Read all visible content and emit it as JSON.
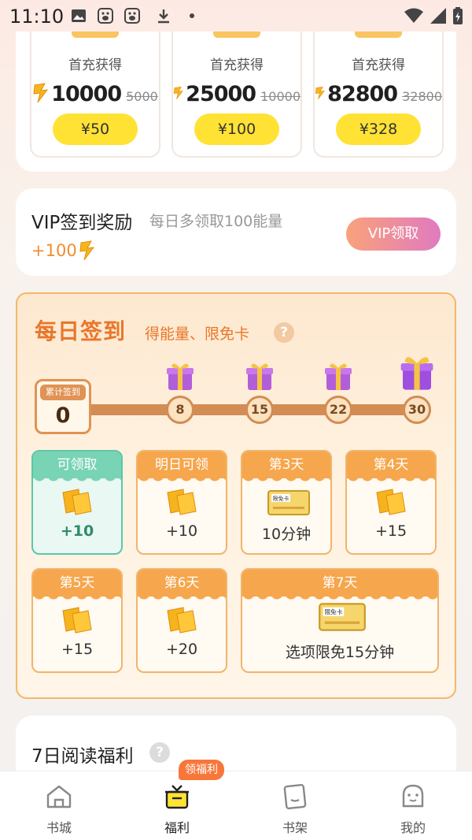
{
  "status_bar": {
    "time": "11:10",
    "icons": [
      "gallery-icon",
      "baidu-icon",
      "baidu-icon",
      "download-icon",
      "dot-icon",
      "wifi-icon",
      "signal-icon",
      "battery-icon"
    ]
  },
  "recharge": {
    "packs": [
      {
        "label": "首充获得",
        "amount": "10000",
        "original": "5000",
        "price": "¥50"
      },
      {
        "label": "首充获得",
        "amount": "25000",
        "original": "10000",
        "price": "¥100"
      },
      {
        "label": "首充获得",
        "amount": "82800",
        "original": "32800",
        "price": "¥328"
      }
    ]
  },
  "vip": {
    "title": "VIP签到奖励",
    "subtitle": "每日多领取100能量",
    "bonus": "+100",
    "button": "VIP领取",
    "button_gradient": [
      "#f9a27a",
      "#e07ac0"
    ]
  },
  "daily_sign": {
    "title": "每日签到",
    "subtitle": "得能量、限免卡",
    "help": "?",
    "streak_label": "累计签到",
    "streak_count": "0",
    "milestones": [
      "8",
      "15",
      "22",
      "30"
    ],
    "days": [
      {
        "caption": "可领取",
        "reward": "+10",
        "icon": "energy-icon",
        "state": "available"
      },
      {
        "caption": "明日可领",
        "reward": "+10",
        "icon": "energy-icon",
        "state": "locked"
      },
      {
        "caption": "第3天",
        "reward": "10分钟",
        "icon": "free-card-icon",
        "state": "locked"
      },
      {
        "caption": "第4天",
        "reward": "+15",
        "icon": "energy-icon",
        "state": "locked"
      },
      {
        "caption": "第5天",
        "reward": "+15",
        "icon": "energy-icon",
        "state": "locked"
      },
      {
        "caption": "第6天",
        "reward": "+20",
        "icon": "energy-icon",
        "state": "locked"
      },
      {
        "caption": "第7天",
        "reward": "选项限免15分钟",
        "icon": "free-card-icon",
        "state": "locked"
      }
    ],
    "card_badge": "限免卡",
    "accent": "#e8772a"
  },
  "reading": {
    "title": "7日阅读福利",
    "help": "?"
  },
  "bottom_nav": {
    "badge": "领福利",
    "items": [
      {
        "label": "书城",
        "icon": "home-icon"
      },
      {
        "label": "福利",
        "icon": "gift-box-icon"
      },
      {
        "label": "书架",
        "icon": "bookshelf-icon"
      },
      {
        "label": "我的",
        "icon": "profile-icon"
      }
    ],
    "active_index": 1
  }
}
